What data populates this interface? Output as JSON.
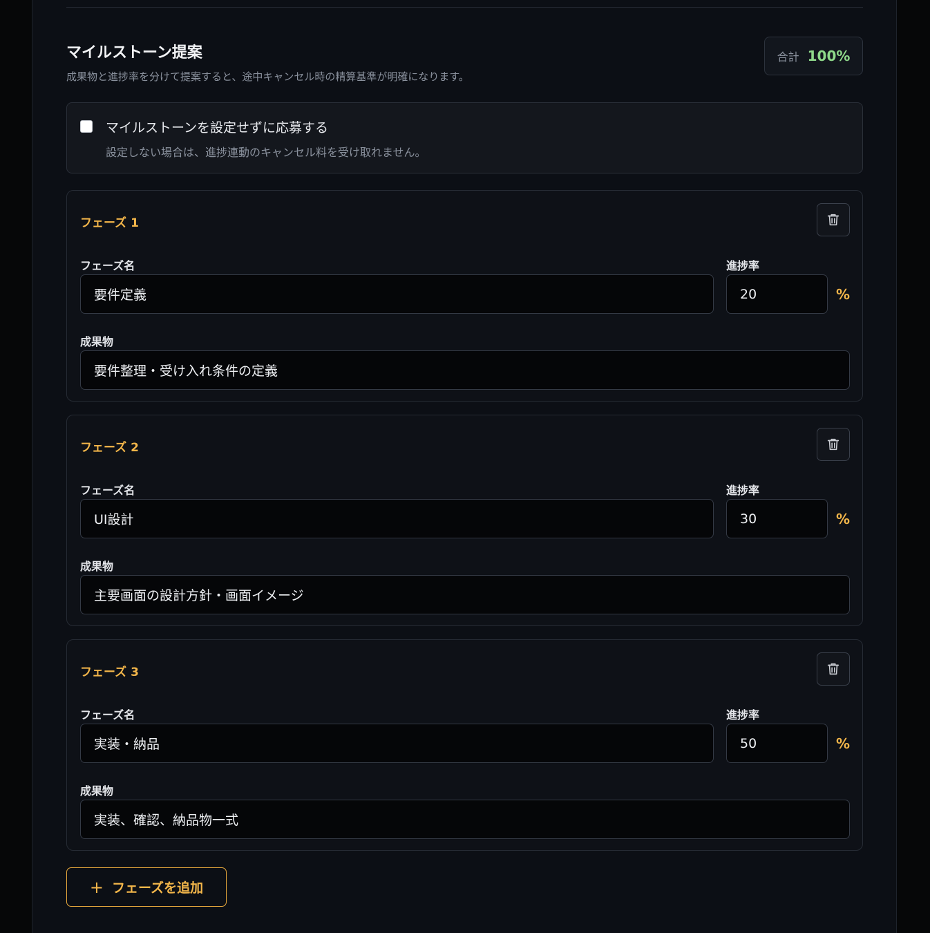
{
  "section": {
    "title": "マイルストーン提案",
    "description": "成果物と進捗率を分けて提案すると、途中キャンセル時の精算基準が明確になります。",
    "total_label": "合計",
    "total_value": "100%"
  },
  "no_milestone": {
    "checked": false,
    "label": "マイルストーンを設定せずに応募する",
    "hint": "設定しない場合は、進捗連動のキャンセル料を受け取れません。"
  },
  "field_labels": {
    "name": "フェーズ名",
    "progress": "進捗率",
    "deliverable": "成果物",
    "percent_sign": "%"
  },
  "phases": [
    {
      "title": "フェーズ 1",
      "name": "要件定義",
      "progress": "20",
      "deliverable": "要件整理・受け入れ条件の定義"
    },
    {
      "title": "フェーズ 2",
      "name": "UI設計",
      "progress": "30",
      "deliverable": "主要画面の設計方針・画面イメージ"
    },
    {
      "title": "フェーズ 3",
      "name": "実装・納品",
      "progress": "50",
      "deliverable": "実装、確認、納品物一式"
    }
  ],
  "add_button": {
    "icon": "plus-icon",
    "label": "フェーズを追加"
  },
  "colors": {
    "accent": "#f3b64a",
    "total_ok": "#8fd98a",
    "background": "#0c0f15"
  }
}
